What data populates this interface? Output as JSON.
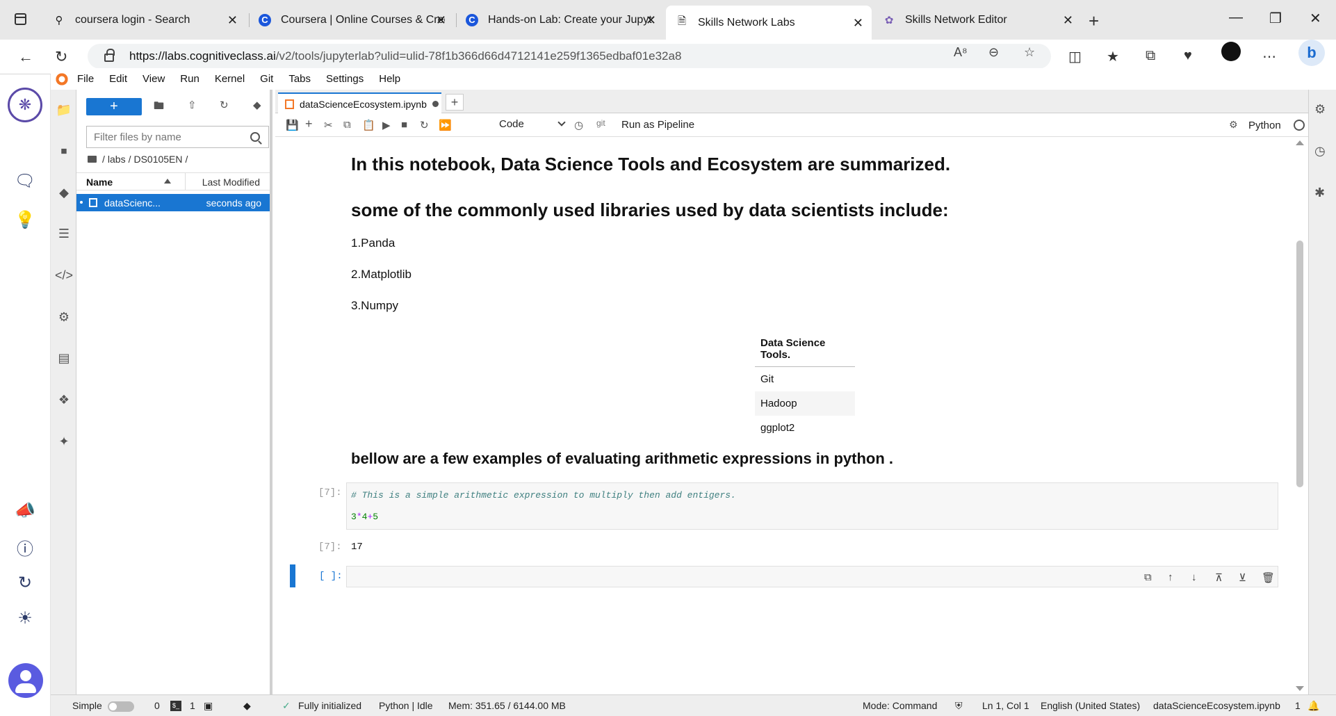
{
  "browser": {
    "tabs": [
      {
        "title": "coursera login - Search",
        "icon": "search-icon"
      },
      {
        "title": "Coursera | Online Courses & Crec",
        "icon": "coursera-icon"
      },
      {
        "title": "Hands-on Lab: Create your Jupyt",
        "icon": "coursera-icon"
      },
      {
        "title": "Skills Network Labs",
        "icon": "page-icon",
        "active": true
      },
      {
        "title": "Skills Network Editor",
        "icon": "skills-network-icon"
      }
    ],
    "url_domain": "https://labs.cognitiveclass.ai",
    "url_path": "/v2/tools/jupyterlab?ulid=ulid-78f1b366d66d4712141e259f1365edbaf01e32a8"
  },
  "menu": [
    "File",
    "Edit",
    "View",
    "Run",
    "Kernel",
    "Git",
    "Tabs",
    "Settings",
    "Help"
  ],
  "file_browser": {
    "new_button": "+",
    "filter_placeholder": "Filter files by name",
    "breadcrumb": [
      "/",
      "labs",
      "/",
      "DS0105EN",
      "/"
    ],
    "col_name": "Name",
    "col_modified": "Last Modified",
    "files": [
      {
        "name": "dataScienc...",
        "modified": "seconds ago"
      }
    ]
  },
  "notebook": {
    "tab_title": "dataScienceEcosystem.ipynb",
    "cell_type": "Code",
    "git_label": "git",
    "run_pipeline": "Run as Pipeline",
    "kernel": "Python",
    "heading_summary": "In this notebook, Data Science Tools and Ecosystem are summarized.",
    "heading_libraries": "some of the commonly used libraries used by data scientists include:",
    "libraries": [
      "1.Panda",
      "2.Matplotlib",
      "3.Numpy"
    ],
    "table_header": "Data Science Tools.",
    "table_rows": [
      "Git",
      "Hadoop",
      "ggplot2"
    ],
    "heading_examples": "bellow are a few examples of evaluating arithmetic expressions in python .",
    "code_prompt": "[7]:",
    "code_comment": "# This is a simple arithmetic expression to multiply then add entigers.",
    "code_n1": "3",
    "code_op1": "*",
    "code_n2": "4",
    "code_op2": "+",
    "code_n3": "5",
    "output_prompt": "[7]:",
    "output_value": "17",
    "empty_prompt": "[ ]:"
  },
  "status": {
    "mode_simple": "Simple",
    "terminals": "0",
    "kernels": "1",
    "initialized": "Fully initialized",
    "kernel_status": "Python | Idle",
    "memory": "Mem: 351.65 / 6144.00 MB",
    "mode": "Mode: Command",
    "position": "Ln 1, Col 1",
    "language": "English (United States)",
    "filename": "dataScienceEcosystem.ipynb",
    "count": "1"
  },
  "colors": {
    "accent": "#1976d2",
    "jupyter_orange": "#f37726",
    "rail_logo": "#5b4aa8"
  }
}
